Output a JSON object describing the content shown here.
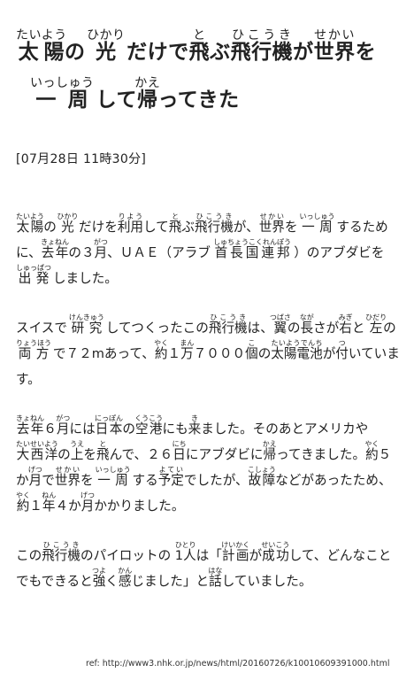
{
  "title": {
    "line1": [
      {
        "t": "太陽",
        "r": "たいよう"
      },
      {
        "t": "の "
      },
      {
        "t": "光",
        "r": "ひかり"
      },
      {
        "t": " だけで"
      },
      {
        "t": "飛",
        "r": "と"
      },
      {
        "t": "ぶ"
      },
      {
        "t": "飛行機",
        "r": "ひこうき"
      },
      {
        "t": "が"
      },
      {
        "t": "世界",
        "r": "せかい"
      },
      {
        "t": "を"
      }
    ],
    "line2": [
      {
        "t": "一周",
        "r": "いっしゅう"
      },
      {
        "t": " して"
      },
      {
        "t": "帰",
        "r": "かえ"
      },
      {
        "t": "ってきた"
      }
    ]
  },
  "date": "[07月28日 11時30分]",
  "paragraphs": [
    [
      {
        "t": "太陽",
        "r": "たいよう"
      },
      {
        "t": "の "
      },
      {
        "t": "光",
        "r": "ひかり"
      },
      {
        "t": " だけを"
      },
      {
        "t": "利用",
        "r": "りよう"
      },
      {
        "t": "して"
      },
      {
        "t": "飛",
        "r": "と"
      },
      {
        "t": "ぶ"
      },
      {
        "t": "飛行機",
        "r": "ひこうき"
      },
      {
        "t": "が、"
      },
      {
        "t": "世界",
        "r": "せかい"
      },
      {
        "t": "を "
      },
      {
        "t": "一周",
        "r": "いっしゅう"
      },
      {
        "t": " するために、"
      },
      {
        "t": "去年",
        "r": "きょねん"
      },
      {
        "t": "の３"
      },
      {
        "t": "月",
        "r": "がつ"
      },
      {
        "t": "、ＵＡＥ（アラブ "
      },
      {
        "t": "首長国連邦",
        "r": "しゅちょうこくれんぽう"
      },
      {
        "t": " ）のアブダビを "
      },
      {
        "t": "出発",
        "r": "しゅっぱつ"
      },
      {
        "t": " しました。"
      }
    ],
    [
      {
        "t": "スイスで "
      },
      {
        "t": "研究",
        "r": "けんきゅう"
      },
      {
        "t": " してつくったこの"
      },
      {
        "t": "飛行機",
        "r": "ひこうき"
      },
      {
        "t": "は、"
      },
      {
        "t": "翼",
        "r": "つばさ"
      },
      {
        "t": "の"
      },
      {
        "t": "長",
        "r": "なが"
      },
      {
        "t": "さが"
      },
      {
        "t": "右",
        "r": "みぎ"
      },
      {
        "t": "と "
      },
      {
        "t": "左",
        "r": "ひだり"
      },
      {
        "t": "の "
      },
      {
        "t": "両方",
        "r": "りょうほう"
      },
      {
        "t": " で７２mあって、"
      },
      {
        "t": "約",
        "r": "やく"
      },
      {
        "t": "１"
      },
      {
        "t": "万",
        "r": "まん"
      },
      {
        "t": "７０００"
      },
      {
        "t": "個",
        "r": "こ"
      },
      {
        "t": "の"
      },
      {
        "t": "太陽電池",
        "r": "たいようでんち"
      },
      {
        "t": "が"
      },
      {
        "t": "付",
        "r": "つ"
      },
      {
        "t": "いています。"
      }
    ],
    [
      {
        "t": "去年",
        "r": "きょねん"
      },
      {
        "t": "６"
      },
      {
        "t": "月",
        "r": "がつ"
      },
      {
        "t": "には"
      },
      {
        "t": "日本",
        "r": "にっぽん"
      },
      {
        "t": "の"
      },
      {
        "t": "空港",
        "r": "くうこう"
      },
      {
        "t": "にも"
      },
      {
        "t": "来",
        "r": "き"
      },
      {
        "t": "ました。そのあとアメリカや "
      },
      {
        "t": "大西洋",
        "r": "たいせいよう"
      },
      {
        "t": "の"
      },
      {
        "t": "上",
        "r": "うえ"
      },
      {
        "t": "を"
      },
      {
        "t": "飛",
        "r": "と"
      },
      {
        "t": "んで、２６"
      },
      {
        "t": "日",
        "r": "にち"
      },
      {
        "t": "にアブダビに"
      },
      {
        "t": "帰",
        "r": "かえ"
      },
      {
        "t": "ってきました。"
      },
      {
        "t": "約",
        "r": "やく"
      },
      {
        "t": "５か"
      },
      {
        "t": "月",
        "r": "げつ"
      },
      {
        "t": "で"
      },
      {
        "t": "世界",
        "r": "せかい"
      },
      {
        "t": "を "
      },
      {
        "t": "一周",
        "r": "いっしゅう"
      },
      {
        "t": " する"
      },
      {
        "t": "予定",
        "r": "よてい"
      },
      {
        "t": "でしたが、"
      },
      {
        "t": "故障",
        "r": "こしょう"
      },
      {
        "t": "などがあったため、"
      },
      {
        "t": "約",
        "r": "やく"
      },
      {
        "t": "１"
      },
      {
        "t": "年",
        "r": "ねん"
      },
      {
        "t": "４か"
      },
      {
        "t": "月",
        "r": "げつ"
      },
      {
        "t": "かかりました。"
      }
    ],
    [
      {
        "t": "この"
      },
      {
        "t": "飛行機",
        "r": "ひこうき"
      },
      {
        "t": "のパイロットの "
      },
      {
        "t": "1人",
        "r": "ひとり"
      },
      {
        "t": "は「"
      },
      {
        "t": "計画",
        "r": "けいかく"
      },
      {
        "t": "が"
      },
      {
        "t": "成功",
        "r": "せいこう"
      },
      {
        "t": "して、どんなことでもできると"
      },
      {
        "t": "強",
        "r": "つよ"
      },
      {
        "t": "く"
      },
      {
        "t": "感",
        "r": "かん"
      },
      {
        "t": "じました」と"
      },
      {
        "t": "話",
        "r": "はな"
      },
      {
        "t": "していました。"
      }
    ]
  ],
  "reference": "ref: http://www3.nhk.or.jp/news/html/20160726/k10010609391000.html"
}
